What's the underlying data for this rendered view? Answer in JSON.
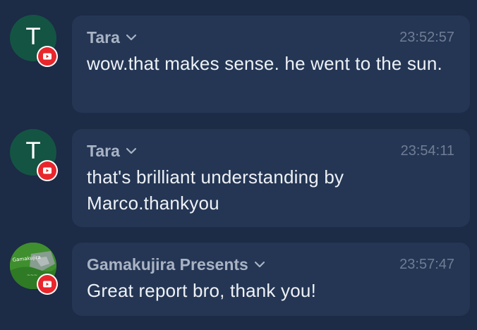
{
  "colors": {
    "background": "#1c2b46",
    "bubble": "#243654",
    "name_text": "#a9b3c4",
    "time_text": "#6f7d94",
    "message_text": "#eef1f6",
    "avatar_tara": "#145443",
    "youtube_red": "#e8262c"
  },
  "messages": [
    {
      "author": "Tara",
      "avatar_letter": "T",
      "badge_icon": "youtube-icon",
      "time": "23:52:57",
      "text": "wow.that makes sense. he went to the sun."
    },
    {
      "author": "Tara",
      "avatar_letter": "T",
      "badge_icon": "youtube-icon",
      "time": "23:54:11",
      "text": "that's brilliant understanding by Marco.thankyou"
    },
    {
      "author": "Gamakujira Presents",
      "avatar_image": "Gamakujira Presents",
      "badge_icon": "youtube-icon",
      "time": "23:57:47",
      "text": "Great report bro, thank you!"
    }
  ]
}
